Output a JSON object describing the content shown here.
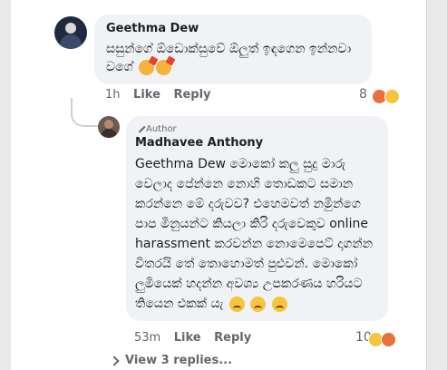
{
  "comment1": {
    "author": "Geethma Dew",
    "text": "සසුන්ගේ ඕඩොක්සුවේ ඕලුත් ඉඳගෙන ඉන්නවා වගේ",
    "time": "1h",
    "like_label": "Like",
    "reply_label": "Reply",
    "reaction_count": "8"
  },
  "comment2": {
    "badge": "Author",
    "author": "Madhavee Anthony",
    "mention": "Geethma Dew",
    "text": "මොකෝ කලු සුදු මාරු වෙලාද පේන්නෙ නොහි තොඩකට සමාන කරන්නෙ මේ දරුවව? එහෙමවත් නමිුන්ගෙ පාප මිනුයන්ට කියලා කිරි දරුවෙකුව online harassment කරවන්න නොමෙපෙට් දාගන්න විතරයි තේ තොහොමත් පුළුවන්. මොකෝ ලුමියෙක් හදන්න අවශ්‍ය උපකරණය හරියට තියෙන එකක් යැ",
    "time": "53m",
    "like_label": "Like",
    "reply_label": "Reply",
    "reaction_count": "10"
  },
  "view_replies": "View 3 replies..."
}
